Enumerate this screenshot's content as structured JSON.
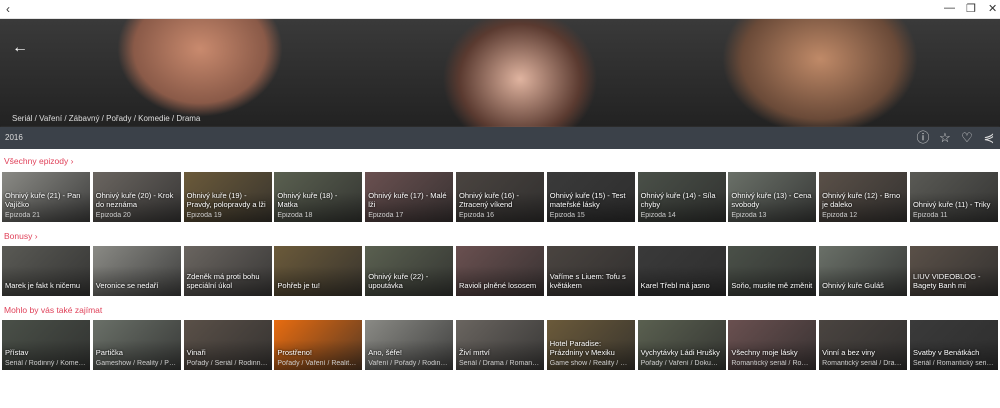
{
  "window": {
    "back_icon": "chevron-left",
    "controls": [
      "minimize",
      "restore",
      "close"
    ]
  },
  "hero": {
    "genres": "Seriál / Vaření / Zábavný / Pořady / Komedie / Drama"
  },
  "info": {
    "year": "2016",
    "icons": [
      "info-icon",
      "star-icon",
      "heart-icon",
      "share-icon"
    ]
  },
  "sections": {
    "episodes": {
      "label": "Všechny epizody ›",
      "items": [
        {
          "title": "Ohnivý kuře (21) - Pan Vajíčko",
          "sub": "Epizoda 21"
        },
        {
          "title": "Ohnivý kuře (20) - Krok do neznáma",
          "sub": "Epizoda 20"
        },
        {
          "title": "Ohnivý kuře (19) - Pravdy, polopravdy a lži",
          "sub": "Epizoda 19"
        },
        {
          "title": "Ohnivý kuře (18) - Matka",
          "sub": "Epizoda 18"
        },
        {
          "title": "Ohnivý kuře (17) - Malé lži",
          "sub": "Epizoda 17"
        },
        {
          "title": "Ohnivý kuře (16) - Ztracený víkend",
          "sub": "Epizoda 16"
        },
        {
          "title": "Ohnivý kuře (15) - Test mateřské lásky",
          "sub": "Epizoda 15"
        },
        {
          "title": "Ohnivý kuře (14) - Síla chyby",
          "sub": "Epizoda 14"
        },
        {
          "title": "Ohnivý kuře (13) - Cena svobody",
          "sub": "Epizoda 13"
        },
        {
          "title": "Ohnivý kuře (12) - Brno je daleko",
          "sub": "Epizoda 12"
        },
        {
          "title": "Ohnivý kuře (11) - Triky",
          "sub": "Epizoda 11"
        }
      ]
    },
    "bonus": {
      "label": "Bonusy ›",
      "items": [
        {
          "title": "Marek je fakt k ničemu"
        },
        {
          "title": "Veronice se nedaří"
        },
        {
          "title": "Zdeněk má proti bohu speciální úkol"
        },
        {
          "title": "Pohřeb je tu!"
        },
        {
          "title": "Ohnivý kuře (22) - upoutávka"
        },
        {
          "title": "Ravioli plněné lososem"
        },
        {
          "title": "Vaříme s Liuem: Tofu s květákem"
        },
        {
          "title": "Karel Třebl má jasno"
        },
        {
          "title": "Soňo, musíte mě změnit"
        },
        {
          "title": "Ohnivý kuře Guláš"
        },
        {
          "title": "LIUV VIDEOBLOG - Bagety Banh mi"
        }
      ]
    },
    "related": {
      "label": "Mohlo by vás také zajímat",
      "items": [
        {
          "title": "Přístav",
          "sub": "Seriál / Rodinný / Komedie"
        },
        {
          "title": "Partička",
          "sub": "Gameshow / Reality / Pořady"
        },
        {
          "title": "Vinaři",
          "sub": "Pořady / Seriál / Rodinný / ..."
        },
        {
          "title": "Prostřeno!",
          "sub": "Pořady / Vaření / Reality / D..."
        },
        {
          "title": "Ano, šéfe!",
          "sub": "Vaření / Pořady / Rodinný / ..."
        },
        {
          "title": "Živí mrtví",
          "sub": "Seriál / Drama / Romantický"
        },
        {
          "title": "Hotel Paradise: Prázdniny v Mexiku",
          "sub": "Game show / Reality / Dobr..."
        },
        {
          "title": "Vychytávky Ládi Hrušky",
          "sub": "Pořady / Vaření / Dokument..."
        },
        {
          "title": "Všechny moje lásky",
          "sub": "Romantický seriál / Romant..."
        },
        {
          "title": "Vinní a bez viny",
          "sub": "Romantický seriál / Drama /"
        },
        {
          "title": "Svatby v Benátkách",
          "sub": "Seriál / Romantický seriál / ..."
        }
      ]
    }
  },
  "colors": {
    "accent": "#e0425a",
    "infobar": "#3b4149"
  }
}
